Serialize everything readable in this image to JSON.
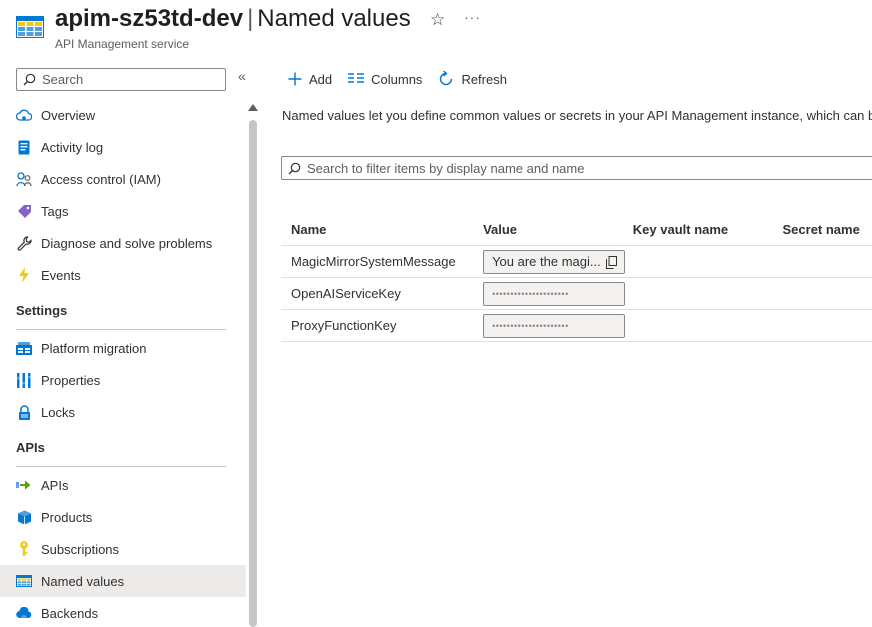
{
  "header": {
    "resource_name": "apim-sz53td-dev",
    "separator": "|",
    "page_name": "Named values",
    "subtitle": "API Management service",
    "star_glyph": "☆",
    "more_glyph": "···"
  },
  "sidebar": {
    "search_placeholder": "Search",
    "collapse_glyph": "«",
    "items_top": [
      {
        "label": "Overview",
        "icon": "cloud-overview-icon"
      },
      {
        "label": "Activity log",
        "icon": "activity-log-icon"
      },
      {
        "label": "Access control (IAM)",
        "icon": "people-icon"
      },
      {
        "label": "Tags",
        "icon": "tag-icon"
      },
      {
        "label": "Diagnose and solve problems",
        "icon": "wrench-icon"
      },
      {
        "label": "Events",
        "icon": "lightning-icon"
      }
    ],
    "section_settings": "Settings",
    "items_settings": [
      {
        "label": "Platform migration",
        "icon": "migration-icon"
      },
      {
        "label": "Properties",
        "icon": "properties-icon"
      },
      {
        "label": "Locks",
        "icon": "lock-icon"
      }
    ],
    "section_apis": "APIs",
    "items_apis": [
      {
        "label": "APIs",
        "icon": "api-arrow-icon"
      },
      {
        "label": "Products",
        "icon": "product-box-icon"
      },
      {
        "label": "Subscriptions",
        "icon": "key-icon"
      },
      {
        "label": "Named values",
        "icon": "table-grid-icon",
        "active": true
      },
      {
        "label": "Backends",
        "icon": "cloud-backend-icon"
      }
    ]
  },
  "toolbar": {
    "add_label": "Add",
    "columns_label": "Columns",
    "refresh_label": "Refresh"
  },
  "main": {
    "description": "Named values let you define common values or secrets in your API Management instance, which can be",
    "filter_placeholder": "Search to filter items by display name and name"
  },
  "table": {
    "columns": [
      "Name",
      "Value",
      "Key vault name",
      "Secret name"
    ],
    "rows": [
      {
        "name": "MagicMirrorSystemMessage",
        "value": "You are the magi...",
        "masked": false
      },
      {
        "name": "OpenAIServiceKey",
        "value": "•••••••••••••••••••••",
        "masked": true
      },
      {
        "name": "ProxyFunctionKey",
        "value": "•••••••••••••••••••••",
        "masked": true
      }
    ]
  },
  "colors": {
    "accent_blue": "#0078d4",
    "active_bg": "#edebe9",
    "border": "#8a8886"
  }
}
